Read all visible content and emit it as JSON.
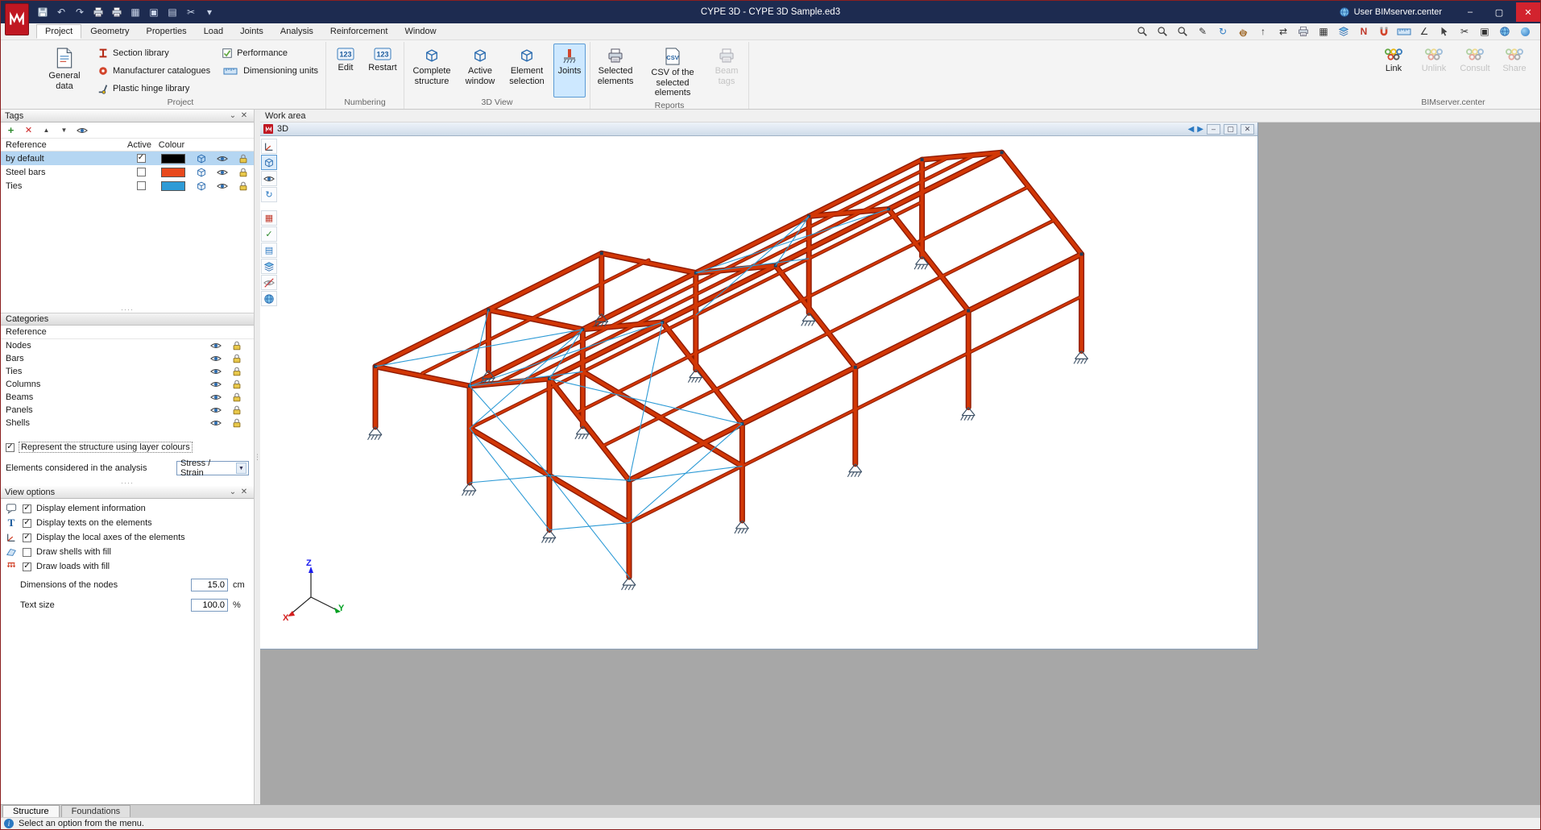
{
  "window": {
    "title": "CYPE 3D - CYPE 3D Sample.ed3",
    "user_label": "User BIMserver.center"
  },
  "icons": {
    "undo": "↶",
    "redo": "↷",
    "refresh": "↻",
    "pencil": "✎",
    "up_arrow": "↑",
    "swap": "⇄",
    "grid": "▦",
    "table": "▤",
    "north": "N",
    "angle": "∠",
    "cut": "✂",
    "tiles": "▣",
    "chevron": "⌄",
    "close": "✕",
    "add": "+",
    "del": "✕",
    "up": "▲",
    "down": "▼",
    "hdots": "····",
    "vdots": "⋮",
    "minimize": "–",
    "maximize": "▢",
    "info": "i",
    "caret": "▾",
    "check": "✓",
    "text_t": "T",
    "prev": "◀",
    "next": "▶",
    "threed": "3D"
  },
  "menu_tabs": [
    {
      "label": "Project",
      "active": true
    },
    {
      "label": "Geometry",
      "active": false
    },
    {
      "label": "Properties",
      "active": false
    },
    {
      "label": "Load",
      "active": false
    },
    {
      "label": "Joints",
      "active": false
    },
    {
      "label": "Analysis",
      "active": false
    },
    {
      "label": "Reinforcement",
      "active": false
    },
    {
      "label": "Window",
      "active": false
    }
  ],
  "ribbon": {
    "project": {
      "group_label": "Project",
      "general_data": "General data",
      "items": [
        "Section library",
        "Manufacturer catalogues",
        "Plastic hinge library",
        "Performance",
        "Dimensioning units"
      ]
    },
    "numbering": {
      "group_label": "Numbering",
      "edit": "Edit",
      "restart": "Restart"
    },
    "view3d": {
      "group_label": "3D View",
      "complete": "Complete structure",
      "active_window": "Active window",
      "element": "Element selection",
      "joints": "Joints",
      "joints_active": true
    },
    "reports": {
      "group_label": "Reports",
      "selected": "Selected elements",
      "csv": "CSV of the selected elements",
      "beam_tags": "Beam tags",
      "beam_tags_disabled": true
    },
    "bimserver": {
      "group_label": "BIMserver.center",
      "link": "Link",
      "unlink": "Unlink",
      "consult": "Consult",
      "share": "Share",
      "unlink_disabled": true,
      "consult_disabled": true,
      "share_disabled": true
    }
  },
  "tags_panel": {
    "title": "Tags",
    "columns": {
      "reference": "Reference",
      "active": "Active",
      "colour": "Colour"
    },
    "rows": [
      {
        "reference": "by default",
        "active": true,
        "colour": "#000000",
        "selected": true
      },
      {
        "reference": "Steel bars",
        "active": false,
        "colour": "#E8491D",
        "selected": false
      },
      {
        "reference": "Ties",
        "active": false,
        "colour": "#2E9BD6",
        "selected": false
      }
    ]
  },
  "categories_panel": {
    "title": "Categories",
    "column": "Reference",
    "rows": [
      "Nodes",
      "Bars",
      "Ties",
      "Columns",
      "Beams",
      "Panels",
      "Shells"
    ]
  },
  "options": {
    "layer_colours": {
      "label": "Represent the structure using layer colours",
      "checked": true
    },
    "analysis": {
      "label": "Elements considered in the analysis",
      "value": "Stress / Strain"
    }
  },
  "view_options": {
    "title": "View options",
    "items": [
      {
        "label": "Display element information",
        "checked": true
      },
      {
        "label": "Display texts on the elements",
        "checked": true
      },
      {
        "label": "Display the local axes of the elements",
        "checked": true
      },
      {
        "label": "Draw shells with fill",
        "checked": false
      },
      {
        "label": "Draw loads with fill",
        "checked": true
      }
    ],
    "nodes": {
      "label": "Dimensions of the nodes",
      "value": "15.0",
      "unit": "cm"
    },
    "text": {
      "label": "Text size",
      "value": "100.0",
      "unit": "%"
    }
  },
  "work_area": {
    "title": "Work area",
    "window_title": "3D",
    "axes": {
      "x": "X",
      "y": "Y",
      "z": "Z"
    }
  },
  "status_bar": {
    "tabs": [
      {
        "label": "Structure",
        "active": true
      },
      {
        "label": "Foundations",
        "active": false
      }
    ],
    "message": "Select an option from the menu."
  }
}
